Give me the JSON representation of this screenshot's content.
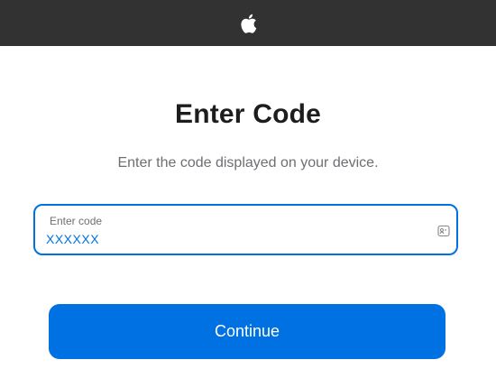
{
  "header": {
    "logo_icon": "apple-logo-icon",
    "background_color": "#323232"
  },
  "main": {
    "title": "Enter Code",
    "subtitle": "Enter the code displayed on your device.",
    "code_field": {
      "label": "Enter code",
      "value": "XXXXXX",
      "trailing_icon": "autofill-key-icon",
      "accent_color": "#0071e3"
    },
    "continue_label": "Continue"
  }
}
